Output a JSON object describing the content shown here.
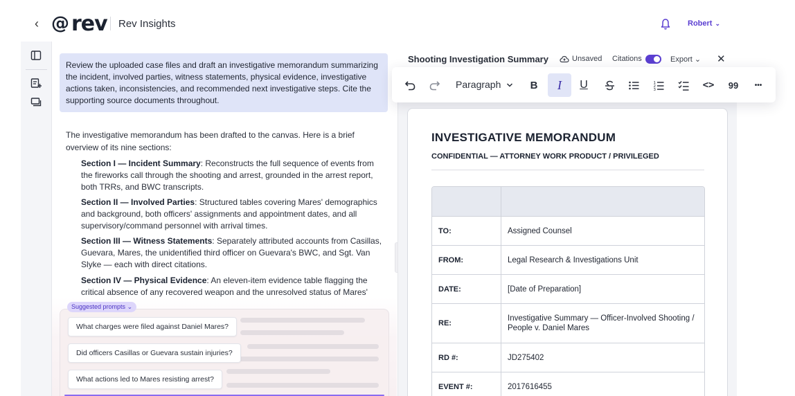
{
  "header": {
    "back_glyph": "‹",
    "logo_at": "@",
    "logo_word": "rev",
    "app_title": "Rev Insights",
    "user_name": "Robert",
    "user_chevron": "⌄"
  },
  "chat": {
    "user_message": "Review the uploaded case files and draft an investigative memorandum summarizing the incident, involved parties, witness statements, physical evidence, investigative actions taken, inconsistencies, and recommended next investigative steps. Cite the supporting source documents throughout.",
    "response_intro": "The investigative memorandum has been drafted to the canvas. Here is a brief overview of its nine sections:",
    "sections": [
      {
        "title": "Section I — Incident Summary",
        "text": ": Reconstructs the full sequence of events from the fireworks call through the shooting and arrest, grounded in the arrest report, both TRRs, and BWC transcripts."
      },
      {
        "title": "Section II — Involved Parties",
        "text": ": Structured tables covering Mares' demographics and background, both officers' assignments and appointment dates, and all supervisory/command personnel with arrival times."
      },
      {
        "title": "Section III — Witness Statements",
        "text": ": Separately attributed accounts from Casillas, Guevara, Mares, the unidentified third officer on Guevara's BWC, and Sgt. Van Slyke — each with direct citations."
      },
      {
        "title": "Section IV — Physical Evidence",
        "text": ": An eleven-item evidence table flagging the critical absence of any recovered weapon and the unresolved status of Mares'"
      }
    ],
    "suggested_label": "Suggested prompts",
    "suggested_chevron": "⌄",
    "prompts": [
      "What charges were filed against Daniel Mares?",
      "Did officers Casillas or Guevara sustain injuries?",
      "What actions led to Mares resisting arrest?"
    ]
  },
  "doc_header": {
    "title": "Shooting Investigation Summary",
    "unsaved": "Unsaved",
    "citations": "Citations",
    "citations_on": true,
    "export": "Export",
    "export_chevron": "⌄",
    "close": "✕"
  },
  "toolbar": {
    "paragraph": "Paragraph",
    "bold": "B",
    "italic": "I",
    "underline": "U",
    "code": "<>",
    "quote": "99",
    "more": "•••",
    "active": "italic"
  },
  "document": {
    "heading": "INVESTIGATIVE MEMORANDUM",
    "subheading": "CONFIDENTIAL — ATTORNEY WORK PRODUCT / PRIVILEGED",
    "rows": [
      {
        "label": "TO:",
        "value": "Assigned Counsel"
      },
      {
        "label": "FROM:",
        "value": "Legal Research & Investigations Unit"
      },
      {
        "label": "DATE:",
        "value": "[Date of Preparation]"
      },
      {
        "label": "RE:",
        "value": "Investigative Summary — Officer-Involved Shooting / People v. Daniel Mares"
      },
      {
        "label": "RD #:",
        "value": "JD275402"
      },
      {
        "label": "EVENT #:",
        "value": "2017616455"
      }
    ]
  },
  "colors": {
    "accent": "#5b3fd1",
    "user_bubble": "#dfe4f8",
    "active_tool": "#e1e5f7"
  }
}
